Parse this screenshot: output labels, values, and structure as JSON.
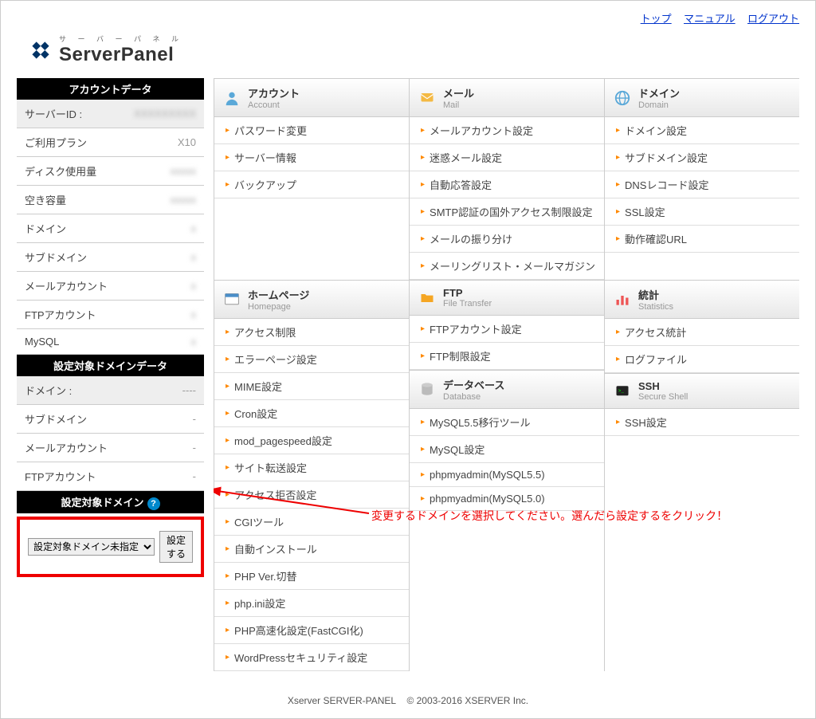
{
  "links": {
    "top": "トップ",
    "manual": "マニュアル",
    "logout": "ログアウト"
  },
  "logo": {
    "sub": "サ ー バ ー パ ネ ル",
    "main": "ServerPanel"
  },
  "sidebar": {
    "section1": {
      "title": "アカウントデータ",
      "rows": [
        {
          "label": "サーバーID :",
          "value": "XXXXXXXXX",
          "gray": true,
          "blur": true
        },
        {
          "label": "ご利用プラン",
          "value": "X10"
        },
        {
          "label": "ディスク使用量",
          "value": "xxxxx",
          "blur": true
        },
        {
          "label": "空き容量",
          "value": "xxxxx",
          "blur": true
        },
        {
          "label": "ドメイン",
          "value": "x",
          "blur": true
        },
        {
          "label": "サブドメイン",
          "value": "x",
          "blur": true
        },
        {
          "label": "メールアカウント",
          "value": "x",
          "blur": true
        },
        {
          "label": "FTPアカウント",
          "value": "x",
          "blur": true
        },
        {
          "label": "MySQL",
          "value": "x",
          "blur": true
        }
      ]
    },
    "section2": {
      "title": "設定対象ドメインデータ",
      "rows": [
        {
          "label": "ドメイン :",
          "value": "----",
          "gray": true
        },
        {
          "label": "サブドメイン",
          "value": "-"
        },
        {
          "label": "メールアカウント",
          "value": "-"
        },
        {
          "label": "FTPアカウント",
          "value": "-"
        }
      ]
    },
    "section3": {
      "title": "設定対象ドメイン",
      "select_value": "設定対象ドメイン未指定",
      "button": "設定する"
    }
  },
  "categories": {
    "account": {
      "title": "アカウント",
      "sub": "Account",
      "items": [
        "パスワード変更",
        "サーバー情報",
        "バックアップ"
      ]
    },
    "mail": {
      "title": "メール",
      "sub": "Mail",
      "items": [
        "メールアカウント設定",
        "迷惑メール設定",
        "自動応答設定",
        "SMTP認証の国外アクセス制限設定",
        "メールの振り分け",
        "メーリングリスト・メールマガジン"
      ]
    },
    "domain": {
      "title": "ドメイン",
      "sub": "Domain",
      "items": [
        "ドメイン設定",
        "サブドメイン設定",
        "DNSレコード設定",
        "SSL設定",
        "動作確認URL"
      ]
    },
    "homepage": {
      "title": "ホームページ",
      "sub": "Homepage",
      "items": [
        "アクセス制限",
        "エラーページ設定",
        "MIME設定",
        "Cron設定",
        "mod_pagespeed設定",
        "サイト転送設定",
        "アクセス拒否設定",
        "CGIツール",
        "自動インストール",
        "PHP Ver.切替",
        "php.ini設定",
        "PHP高速化設定(FastCGI化)",
        "WordPressセキュリティ設定"
      ]
    },
    "ftp": {
      "title": "FTP",
      "sub": "File Transfer",
      "items": [
        "FTPアカウント設定",
        "FTP制限設定"
      ]
    },
    "database": {
      "title": "データベース",
      "sub": "Database",
      "items": [
        "MySQL5.5移行ツール",
        "MySQL設定",
        "phpmyadmin(MySQL5.5)",
        "phpmyadmin(MySQL5.0)"
      ]
    },
    "stats": {
      "title": "統計",
      "sub": "Statistics",
      "items": [
        "アクセス統計",
        "ログファイル"
      ]
    },
    "ssh": {
      "title": "SSH",
      "sub": "Secure Shell",
      "items": [
        "SSH設定"
      ]
    }
  },
  "annotation": "変更するドメインを選択してください。選んだら設定するをクリック！",
  "footer": {
    "left": "Xserver SERVER-PANEL",
    "right": "© 2003-2016 XSERVER Inc."
  }
}
